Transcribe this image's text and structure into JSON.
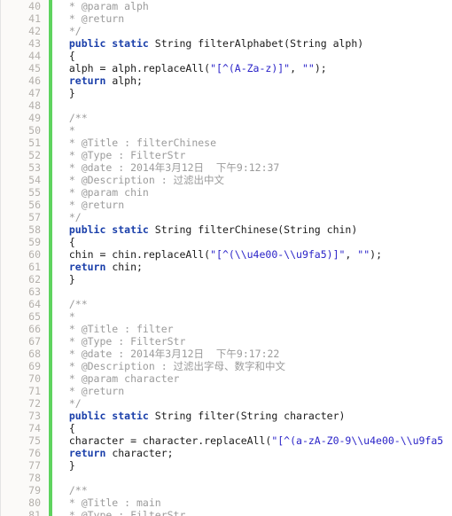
{
  "editor": {
    "language": "java",
    "colors": {
      "background": "#ffffff",
      "gutter_background": "#fbfaf8",
      "line_number": "#b4b0ab",
      "change_marker": "#5fd35f",
      "comment": "#9b9b9b",
      "keyword": "#1a3faa",
      "string": "#2a23c8",
      "plain": "#1a1a1a"
    },
    "first_visible_line": 40,
    "last_visible_line": 81,
    "line_height_px": 14
  },
  "lines": [
    {
      "n": "40",
      "tokens": [
        {
          "t": "comment",
          "s": "  * @param alph"
        }
      ]
    },
    {
      "n": "41",
      "tokens": [
        {
          "t": "comment",
          "s": "  * @return"
        }
      ]
    },
    {
      "n": "42",
      "tokens": [
        {
          "t": "comment",
          "s": "  */"
        }
      ]
    },
    {
      "n": "43",
      "tokens": [
        {
          "t": "keyword",
          "s": "  public static "
        },
        {
          "t": "plain",
          "s": "String filterAlphabet(String alph)"
        }
      ]
    },
    {
      "n": "44",
      "tokens": [
        {
          "t": "plain",
          "s": "  {"
        }
      ]
    },
    {
      "n": "45",
      "tokens": [
        {
          "t": "plain",
          "s": "  alph = alph.replaceAll("
        },
        {
          "t": "string",
          "s": "\"[^(A-Za-z)]\""
        },
        {
          "t": "plain",
          "s": ", "
        },
        {
          "t": "string",
          "s": "\"\""
        },
        {
          "t": "plain",
          "s": ");"
        }
      ]
    },
    {
      "n": "46",
      "tokens": [
        {
          "t": "keyword",
          "s": "  return "
        },
        {
          "t": "plain",
          "s": "alph;"
        }
      ]
    },
    {
      "n": "47",
      "tokens": [
        {
          "t": "plain",
          "s": "  }"
        }
      ]
    },
    {
      "n": "48",
      "tokens": [
        {
          "t": "plain",
          "s": ""
        }
      ]
    },
    {
      "n": "49",
      "tokens": [
        {
          "t": "comment",
          "s": "  /**"
        }
      ]
    },
    {
      "n": "50",
      "tokens": [
        {
          "t": "comment",
          "s": "  *"
        }
      ]
    },
    {
      "n": "51",
      "tokens": [
        {
          "t": "comment",
          "s": "  * @Title : filterChinese"
        }
      ]
    },
    {
      "n": "52",
      "tokens": [
        {
          "t": "comment",
          "s": "  * @Type : FilterStr"
        }
      ]
    },
    {
      "n": "53",
      "tokens": [
        {
          "t": "comment",
          "s": "  * @date : 2014年3月12日  下午9:12:37"
        }
      ]
    },
    {
      "n": "54",
      "tokens": [
        {
          "t": "comment",
          "s": "  * @Description : 过滤出中文"
        }
      ]
    },
    {
      "n": "55",
      "tokens": [
        {
          "t": "comment",
          "s": "  * @param chin"
        }
      ]
    },
    {
      "n": "56",
      "tokens": [
        {
          "t": "comment",
          "s": "  * @return"
        }
      ]
    },
    {
      "n": "57",
      "tokens": [
        {
          "t": "comment",
          "s": "  */"
        }
      ]
    },
    {
      "n": "58",
      "tokens": [
        {
          "t": "keyword",
          "s": "  public static "
        },
        {
          "t": "plain",
          "s": "String filterChinese(String chin)"
        }
      ]
    },
    {
      "n": "59",
      "tokens": [
        {
          "t": "plain",
          "s": "  {"
        }
      ]
    },
    {
      "n": "60",
      "tokens": [
        {
          "t": "plain",
          "s": "  chin = chin.replaceAll("
        },
        {
          "t": "string",
          "s": "\"[^(\\\\u4e00-\\\\u9fa5)]\""
        },
        {
          "t": "plain",
          "s": ", "
        },
        {
          "t": "string",
          "s": "\"\""
        },
        {
          "t": "plain",
          "s": ");"
        }
      ]
    },
    {
      "n": "61",
      "tokens": [
        {
          "t": "keyword",
          "s": "  return "
        },
        {
          "t": "plain",
          "s": "chin;"
        }
      ]
    },
    {
      "n": "62",
      "tokens": [
        {
          "t": "plain",
          "s": "  }"
        }
      ]
    },
    {
      "n": "63",
      "tokens": [
        {
          "t": "plain",
          "s": ""
        }
      ]
    },
    {
      "n": "64",
      "tokens": [
        {
          "t": "comment",
          "s": "  /**"
        }
      ]
    },
    {
      "n": "65",
      "tokens": [
        {
          "t": "comment",
          "s": "  *"
        }
      ]
    },
    {
      "n": "66",
      "tokens": [
        {
          "t": "comment",
          "s": "  * @Title : filter"
        }
      ]
    },
    {
      "n": "67",
      "tokens": [
        {
          "t": "comment",
          "s": "  * @Type : FilterStr"
        }
      ]
    },
    {
      "n": "68",
      "tokens": [
        {
          "t": "comment",
          "s": "  * @date : 2014年3月12日  下午9:17:22"
        }
      ]
    },
    {
      "n": "69",
      "tokens": [
        {
          "t": "comment",
          "s": "  * @Description : 过滤出字母、数字和中文"
        }
      ]
    },
    {
      "n": "70",
      "tokens": [
        {
          "t": "comment",
          "s": "  * @param character"
        }
      ]
    },
    {
      "n": "71",
      "tokens": [
        {
          "t": "comment",
          "s": "  * @return"
        }
      ]
    },
    {
      "n": "72",
      "tokens": [
        {
          "t": "comment",
          "s": "  */"
        }
      ]
    },
    {
      "n": "73",
      "tokens": [
        {
          "t": "keyword",
          "s": "  public static "
        },
        {
          "t": "plain",
          "s": "String filter(String character)"
        }
      ]
    },
    {
      "n": "74",
      "tokens": [
        {
          "t": "plain",
          "s": "  {"
        }
      ]
    },
    {
      "n": "75",
      "tokens": [
        {
          "t": "plain",
          "s": "  character = character.replaceAll("
        },
        {
          "t": "string",
          "s": "\"[^(a-zA-Z0-9\\\\u4e00-\\\\u9fa5"
        }
      ]
    },
    {
      "n": "76",
      "tokens": [
        {
          "t": "keyword",
          "s": "  return "
        },
        {
          "t": "plain",
          "s": "character;"
        }
      ]
    },
    {
      "n": "77",
      "tokens": [
        {
          "t": "plain",
          "s": "  }"
        }
      ]
    },
    {
      "n": "78",
      "tokens": [
        {
          "t": "plain",
          "s": ""
        }
      ]
    },
    {
      "n": "79",
      "tokens": [
        {
          "t": "comment",
          "s": "  /**"
        }
      ]
    },
    {
      "n": "80",
      "tokens": [
        {
          "t": "comment",
          "s": "  * @Title : main"
        }
      ]
    },
    {
      "n": "81",
      "tokens": [
        {
          "t": "comment",
          "s": "  * @Type : FilterStr"
        }
      ]
    }
  ]
}
